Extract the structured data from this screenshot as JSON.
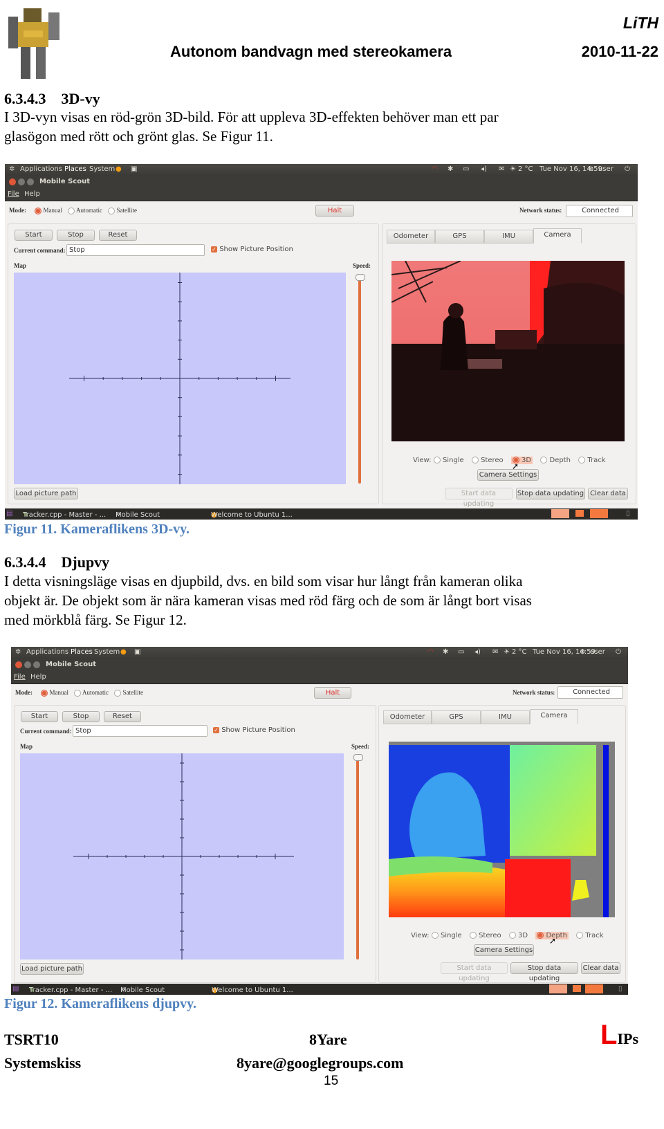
{
  "header": {
    "logo": "robot-logo",
    "org": "LiTH",
    "title": "Autonom bandvagn med stereokamera",
    "date": "2010-11-22"
  },
  "section1": {
    "number": "6.3.4.3",
    "title": "3D-vy",
    "lines": [
      "I 3D-vyn visas en röd-grön 3D-bild. För att uppleva 3D-effekten behöver man ett par",
      "glasögon med rött och grönt glas. Se Figur 11."
    ],
    "caption": "Figur 11. Kameraflikens 3D-vy."
  },
  "section2": {
    "number": "6.3.4.4",
    "title": "Djupvy",
    "lines": [
      "I detta visningsläge visas en djupbild, dvs. en bild som visar hur långt från kameran olika",
      "objekt är. De objekt som är nära kameran visas med röd färg och de som är långt bort visas",
      "med mörkblå färg. Se Figur 12."
    ],
    "caption": "Figur 12. Kameraflikens djupvy."
  },
  "app": {
    "topbar": {
      "menus": [
        "Applications",
        "Places",
        "System"
      ],
      "weather": "2 °C",
      "clock": "Tue Nov 16, 14:59",
      "user": "user"
    },
    "window_title": "Mobile Scout",
    "menu": [
      "File",
      "Help"
    ],
    "mode_label": "Mode:",
    "modes": [
      "Manual",
      "Automatic",
      "Satellite"
    ],
    "selected_mode": "Manual",
    "halt": "Halt",
    "network_label": "Network status:",
    "network_value": "Connected",
    "buttons": [
      "Start",
      "Stop",
      "Reset"
    ],
    "command_label": "Current command:",
    "command_value": "Stop",
    "show_picture_position": "Show Picture Position",
    "show_picture_checked": true,
    "map_label": "Map",
    "speed_label": "Speed:",
    "speed_value": 1.0,
    "load_picture": "Load picture path",
    "tabs": [
      "Odometer",
      "GPS",
      "IMU",
      "Camera"
    ],
    "active_tab": "Camera",
    "view_label": "View:",
    "view_options": [
      "Single",
      "Stereo",
      "3D",
      "Depth",
      "Track"
    ],
    "camera_settings": "Camera Settings",
    "start_updating": "Start data updating",
    "stop_updating": "Stop data updating",
    "clear_data": "Clear data",
    "taskbar": [
      "Tracker.cpp - Master - ...",
      "Mobile Scout",
      "Welcome to Ubuntu 1..."
    ]
  },
  "figures": [
    {
      "selected_view": "3D",
      "image": "red-cyan anaglyph photo of person sitting outdoors"
    },
    {
      "selected_view": "Depth",
      "image": "false-color depth map"
    }
  ],
  "footer": {
    "course": "TSRT10",
    "group": "8Yare",
    "logo_letter": "L",
    "logo_rest": "IPs",
    "doc": "Systemskiss",
    "email": "8yare@googlegroups.com",
    "page": "15"
  }
}
